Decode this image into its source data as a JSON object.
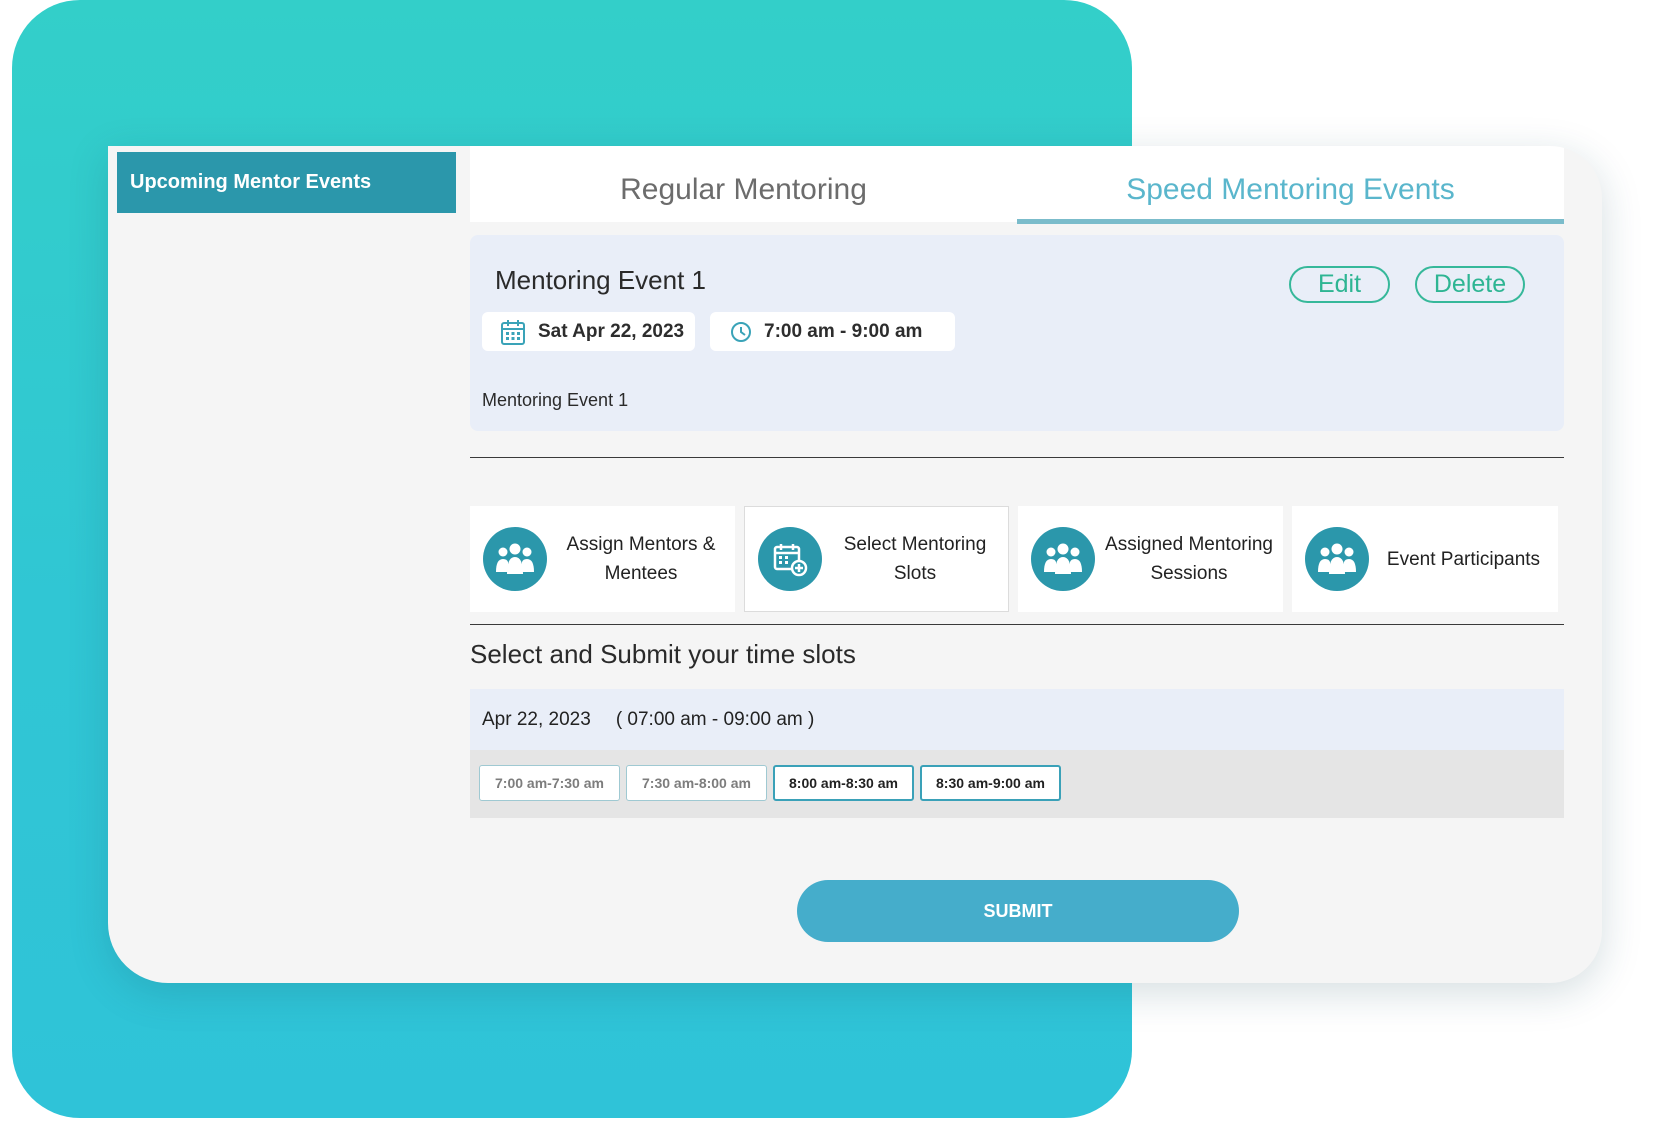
{
  "sidebar": {
    "active_item": "Upcoming Mentor Events"
  },
  "tabs": [
    {
      "label": "Regular Mentoring",
      "active": false
    },
    {
      "label": "Speed Mentoring Events",
      "active": true
    }
  ],
  "event": {
    "title": "Mentoring Event 1",
    "date": "Sat Apr 22, 2023",
    "time": "7:00 am - 9:00 am",
    "description": "Mentoring Event 1",
    "edit_label": "Edit",
    "delete_label": "Delete"
  },
  "actions": [
    {
      "label": "Assign Mentors & Mentees",
      "icon": "people-group-icon"
    },
    {
      "label": "Select Mentoring Slots",
      "icon": "calendar-plus-icon",
      "selected": true
    },
    {
      "label": "Assigned Mentoring Sessions",
      "icon": "people-group-icon"
    },
    {
      "label": "Event Participants",
      "icon": "people-group-icon"
    }
  ],
  "slots_section": {
    "title": "Select and Submit your time slots",
    "date": "Apr 22, 2023",
    "range": "( 07:00 am - 09:00 am )",
    "slots": [
      {
        "label": "7:00 am-7:30 am",
        "available": false
      },
      {
        "label": "7:30 am-8:00 am",
        "available": false
      },
      {
        "label": "8:00 am-8:30 am",
        "available": true
      },
      {
        "label": "8:30 am-9:00 am",
        "available": true
      }
    ],
    "submit_label": "SUBMIT"
  },
  "colors": {
    "brand_teal": "#2b97ab",
    "accent_green": "#2eb593",
    "submit_blue": "#45adcb",
    "background_gradient": "#33cfc9"
  }
}
